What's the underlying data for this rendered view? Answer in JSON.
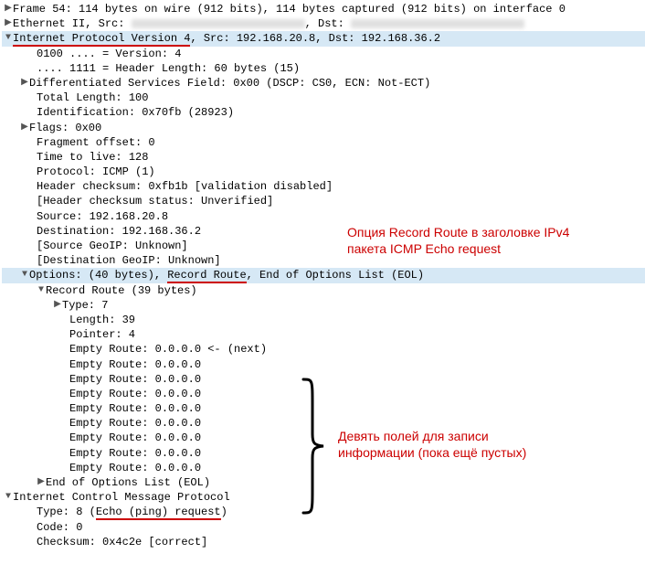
{
  "frame": "Frame 54: 114 bytes on wire (912 bits), 114 bytes captured (912 bits) on interface 0",
  "eth": {
    "pre": "Ethernet II, Src: ",
    "mid": ", Dst: "
  },
  "ipv4": {
    "pre": "Internet Protocol Version 4",
    "post": ", Src: 192.168.20.8, Dst: 192.168.36.2",
    "version": "0100 .... = Version: 4",
    "hdrlen": ".... 1111 = Header Length: 60 bytes (15)",
    "dscp": "Differentiated Services Field: 0x00 (DSCP: CS0, ECN: Not-ECT)",
    "tlen": "Total Length: 100",
    "id": "Identification: 0x70fb (28923)",
    "flags": "Flags: 0x00",
    "fragoff": "Fragment offset: 0",
    "ttl": "Time to live: 128",
    "proto": "Protocol: ICMP (1)",
    "cksum": "Header checksum: 0xfb1b [validation disabled]",
    "cksumstat": "[Header checksum status: Unverified]",
    "src": "Source: 192.168.20.8",
    "dst": "Destination: 192.168.36.2",
    "sgeo": "[Source GeoIP: Unknown]",
    "dgeo": "[Destination GeoIP: Unknown]"
  },
  "opt": {
    "pre": "Options: (40 bytes), ",
    "rr": "Record Route",
    "post": ", End of Options List (EOL)",
    "rrhead": "Record Route (39 bytes)",
    "type": "Type: 7",
    "len": "Length: 39",
    "ptr": "Pointer: 4",
    "er0": "Empty Route: 0.0.0.0 <- (next)",
    "er": "Empty Route: 0.0.0.0",
    "eol": "End of Options List (EOL)"
  },
  "icmp": {
    "head": "Internet Control Message Protocol",
    "typepre": "Type: 8 (",
    "typemid": "Echo (ping) request",
    "typepost": ")",
    "code": "Code: 0",
    "cksum": "Checksum: 0x4c2e [correct]"
  },
  "annot1a": "Опция Record Route в заголовке IPv4",
  "annot1b": "пакета ICMP Echo request",
  "annot2a": "Девять полей для записи",
  "annot2b": "информации (пока ещё пустых)",
  "glyph": {
    "right": "▶",
    "down": "▼"
  }
}
